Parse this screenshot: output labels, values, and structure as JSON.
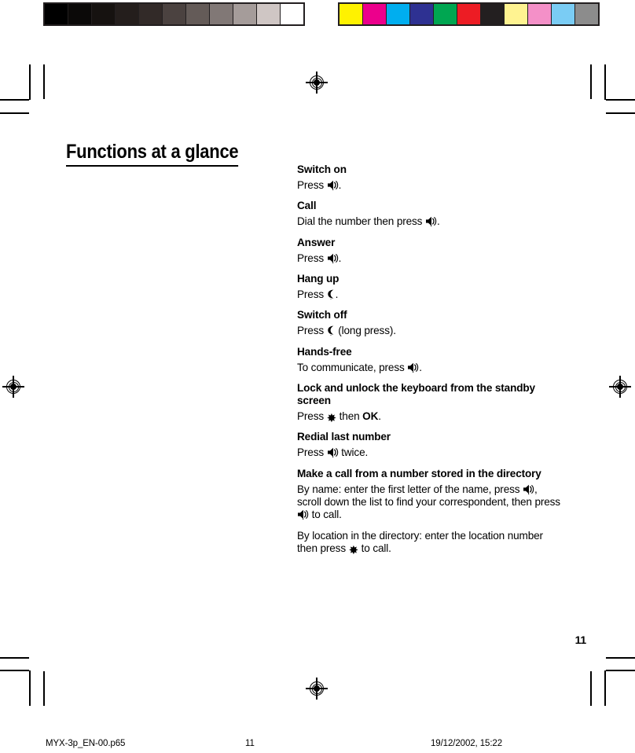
{
  "document": {
    "title": "Functions at a glance",
    "page_number": "11"
  },
  "calibration": {
    "grayscale_label": "grayscale-calibration-bar",
    "grayscale_swatches": [
      "#000000",
      "#0b0908",
      "#161210",
      "#241e1c",
      "#322a28",
      "#4b4240",
      "#645b58",
      "#817876",
      "#a59c9a",
      "#cfc6c4",
      "#ffffff"
    ],
    "color_label": "color-calibration-bar",
    "color_swatches": [
      "#fff200",
      "#ec008c",
      "#00aeef",
      "#2e3192",
      "#00a651",
      "#ed1c24",
      "#231f20",
      "#fff391",
      "#f490c8",
      "#7accf4",
      "#8c8c8c"
    ]
  },
  "sections": [
    {
      "heading": "Switch on",
      "parts": [
        {
          "type": "text",
          "value": "Press "
        },
        {
          "type": "icon",
          "value": "call-key-icon"
        },
        {
          "type": "text",
          "value": "."
        }
      ]
    },
    {
      "heading": "Call",
      "parts": [
        {
          "type": "text",
          "value": "Dial the number then press "
        },
        {
          "type": "icon",
          "value": "call-key-icon"
        },
        {
          "type": "text",
          "value": "."
        }
      ]
    },
    {
      "heading": "Answer",
      "parts": [
        {
          "type": "text",
          "value": "Press "
        },
        {
          "type": "icon",
          "value": "call-key-icon"
        },
        {
          "type": "text",
          "value": "."
        }
      ]
    },
    {
      "heading": "Hang up",
      "parts": [
        {
          "type": "text",
          "value": "Press "
        },
        {
          "type": "icon",
          "value": "hangup-key-icon"
        },
        {
          "type": "text",
          "value": "."
        }
      ]
    },
    {
      "heading": "Switch off",
      "parts": [
        {
          "type": "text",
          "value": "Press "
        },
        {
          "type": "icon",
          "value": "hangup-key-icon"
        },
        {
          "type": "text",
          "value": " (long press)."
        }
      ]
    },
    {
      "heading": "Hands-free",
      "parts": [
        {
          "type": "text",
          "value": "To communicate, press "
        },
        {
          "type": "icon",
          "value": "call-key-icon"
        },
        {
          "type": "text",
          "value": "."
        }
      ]
    },
    {
      "heading": "Lock and unlock the keyboard from the standby screen",
      "parts": [
        {
          "type": "text",
          "value": "Press "
        },
        {
          "type": "icon",
          "value": "star-key-icon"
        },
        {
          "type": "text",
          "value": " then "
        },
        {
          "type": "strong",
          "value": "OK"
        },
        {
          "type": "text",
          "value": "."
        }
      ]
    },
    {
      "heading": "Redial last number",
      "parts": [
        {
          "type": "text",
          "value": "Press "
        },
        {
          "type": "icon",
          "value": "call-key-icon"
        },
        {
          "type": "text",
          "value": " twice."
        }
      ]
    },
    {
      "heading": "Make a call from a number stored in the directory",
      "parts": [
        {
          "type": "text",
          "value": "By name: enter the first letter of the name, press "
        },
        {
          "type": "icon",
          "value": "call-key-icon"
        },
        {
          "type": "text",
          "value": ", scroll down the list to find your correspondent, then press "
        },
        {
          "type": "icon",
          "value": "call-key-icon"
        },
        {
          "type": "text",
          "value": " to call."
        }
      ],
      "extra_parts": [
        {
          "type": "text",
          "value": "By location in the directory: enter the location number then press "
        },
        {
          "type": "icon",
          "value": "star-key-icon"
        },
        {
          "type": "text",
          "value": " to call."
        }
      ]
    }
  ],
  "footer": {
    "file_name": "MYX-3p_EN-00.p65",
    "page": "11",
    "timestamp": "19/12/2002, 15:22"
  }
}
